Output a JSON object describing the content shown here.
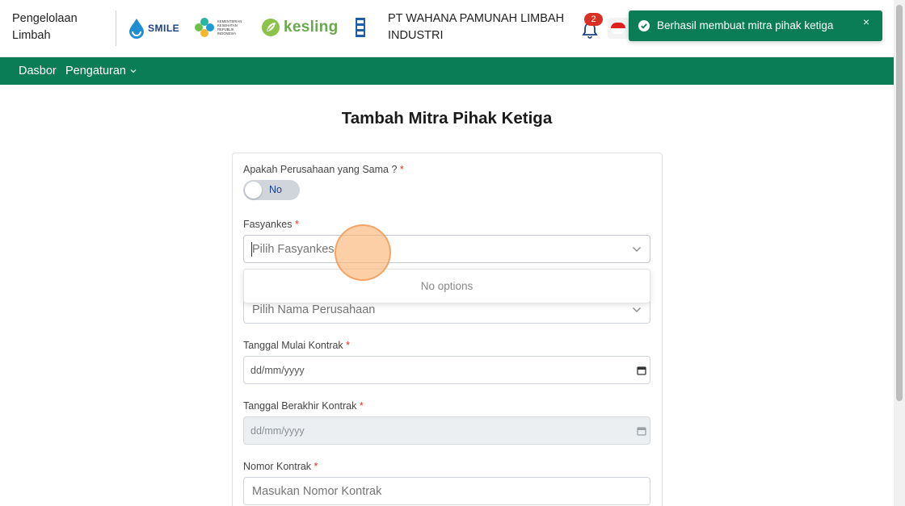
{
  "header": {
    "app_name": "Pengelolaan Limbah",
    "logos": {
      "smile": "SMILE",
      "kesling": "kesling",
      "kemenkes_caption": "KEMENTERIAN KESEHATAN REPUBLIK INDONESIA"
    },
    "company_name": "PT WAHANA PAMUNAH LIMBAH INDUSTRI",
    "notification_count": "2"
  },
  "toast": {
    "message": "Berhasil membuat mitra pihak ketiga",
    "close_symbol": "×"
  },
  "nav": {
    "items": [
      {
        "label": "Dasbor"
      },
      {
        "label": "Pengaturan"
      }
    ]
  },
  "page": {
    "title": "Tambah Mitra Pihak Ketiga"
  },
  "form": {
    "same_company": {
      "label": "Apakah Perusahaan yang Sama ?",
      "required_mark": "*",
      "toggle_text": "No"
    },
    "fasyankes": {
      "label": "Fasyankes",
      "required_mark": "*",
      "placeholder": "Pilih Fasyankes"
    },
    "dropdown": {
      "no_options": "No options"
    },
    "company": {
      "placeholder": "Pilih Nama Perusahaan"
    },
    "start_date": {
      "label": "Tanggal Mulai Kontrak",
      "required_mark": "*",
      "placeholder": "dd/mm/yyyy"
    },
    "end_date": {
      "label": "Tanggal Berakhir Kontrak",
      "required_mark": "*",
      "placeholder": "dd/mm/yyyy"
    },
    "contract_number": {
      "label": "Nomor Kontrak",
      "required_mark": "*",
      "placeholder": "Masukan Nomor Kontrak"
    }
  },
  "colors": {
    "primary_green": "#0a7d57",
    "required_red": "#d93025",
    "badge_red": "#d93025"
  }
}
